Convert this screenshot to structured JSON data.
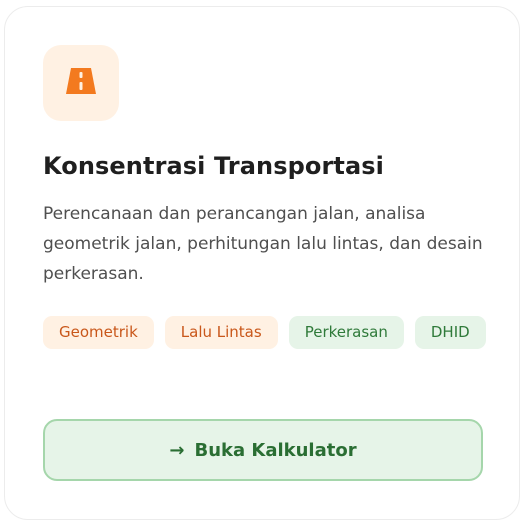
{
  "card": {
    "icon": "road-icon",
    "title": "Konsentrasi Transportasi",
    "description": "Perencanaan dan perancangan jalan, analisa geometrik jalan, perhitungan lalu lintas, dan desain perkerasan.",
    "tags": [
      {
        "label": "Geometrik",
        "color": "#c9571a"
      },
      {
        "label": "Lalu Lintas",
        "color": "#c9571a"
      },
      {
        "label": "Perkerasan",
        "color": "#2f7a3a"
      },
      {
        "label": "DHID",
        "color": "#2f7a3a"
      }
    ],
    "cta": {
      "icon": "arrow-right-icon",
      "label": "Buka Kalkulator"
    }
  },
  "colors": {
    "accent_orange": "#f37a1f",
    "accent_green": "#2a6e33"
  }
}
